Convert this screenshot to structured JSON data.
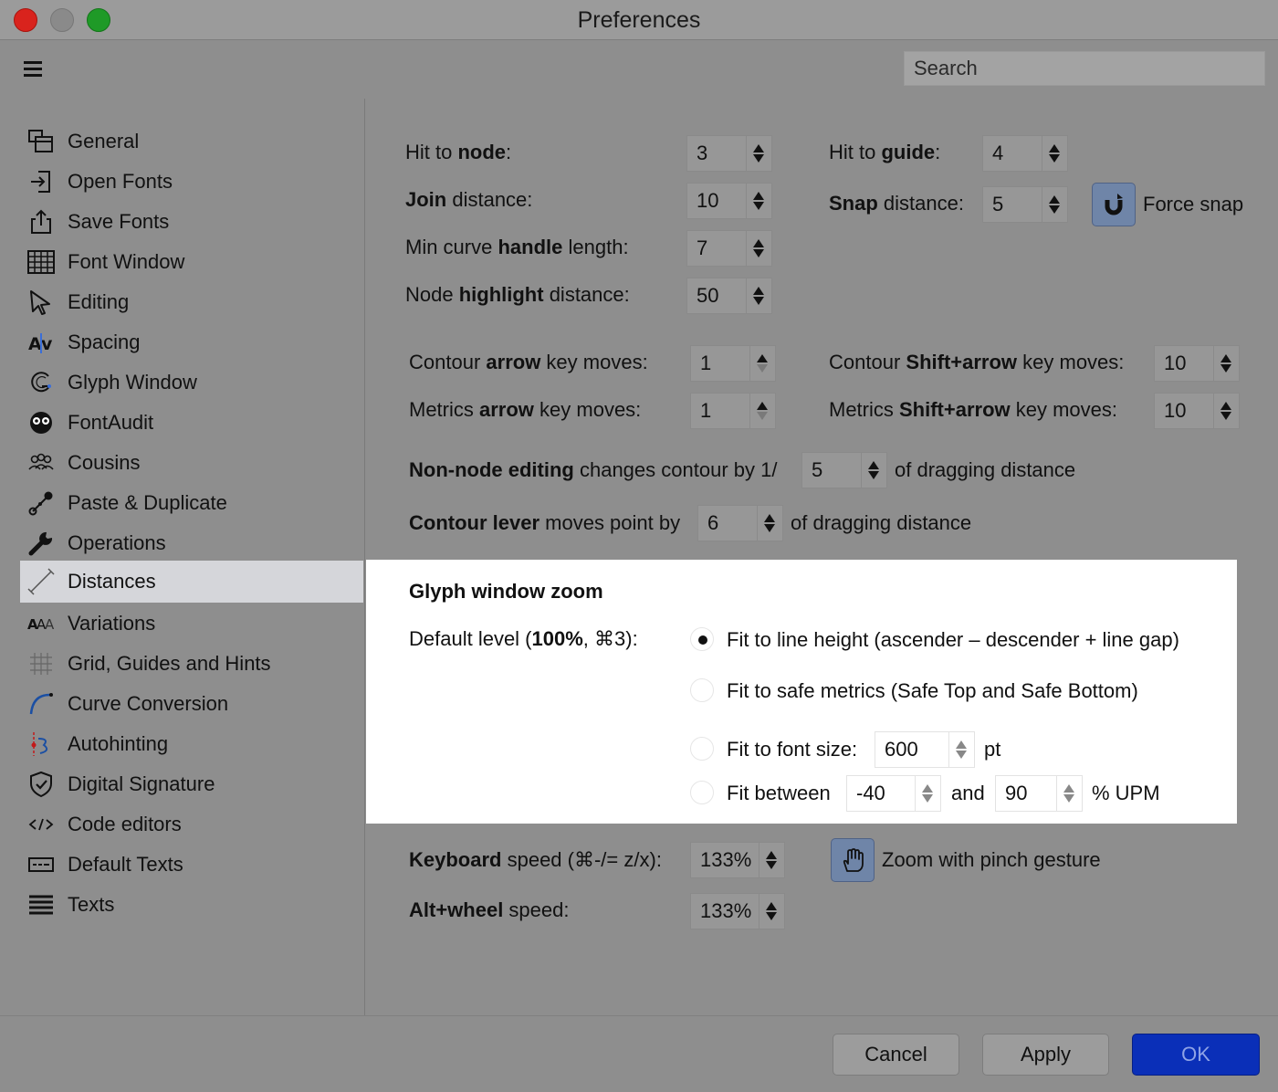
{
  "window": {
    "title": "Preferences"
  },
  "toolbar": {
    "search_placeholder": "Search"
  },
  "sidebar": {
    "items": [
      {
        "label": "General"
      },
      {
        "label": "Open Fonts"
      },
      {
        "label": "Save Fonts"
      },
      {
        "label": "Font Window"
      },
      {
        "label": "Editing"
      },
      {
        "label": "Spacing"
      },
      {
        "label": "Glyph Window"
      },
      {
        "label": "FontAudit"
      },
      {
        "label": "Cousins"
      },
      {
        "label": "Paste & Duplicate"
      },
      {
        "label": "Operations"
      },
      {
        "label": "Distances",
        "selected": true
      },
      {
        "label": "Variations"
      },
      {
        "label": "Grid, Guides and Hints"
      },
      {
        "label": "Curve Conversion"
      },
      {
        "label": "Autohinting"
      },
      {
        "label": "Digital Signature"
      },
      {
        "label": "Code editors"
      },
      {
        "label": "Default Texts"
      },
      {
        "label": "Texts"
      }
    ]
  },
  "main": {
    "hit_to_node": {
      "pre": "Hit to ",
      "bold": "node",
      "post": ":",
      "value": "3"
    },
    "hit_to_guide": {
      "pre": "Hit to ",
      "bold": "guide",
      "post": ":",
      "value": "4"
    },
    "join_distance": {
      "bold": "Join",
      "post": " distance:",
      "value": "10"
    },
    "snap_distance": {
      "bold": "Snap",
      "post": " distance:",
      "value": "5"
    },
    "force_snap": {
      "label": "Force snap"
    },
    "min_curve": {
      "pre": "Min curve ",
      "bold": "handle",
      "post": " length:",
      "value": "7"
    },
    "node_highlight": {
      "pre": "Node ",
      "bold": "highlight",
      "post": " distance:",
      "value": "50"
    },
    "contour_arrow": {
      "pre": "Contour ",
      "bold": "arrow",
      "post": " key moves:",
      "value": "1"
    },
    "contour_shift": {
      "pre": "Contour ",
      "bold": "Shift+arrow",
      "post": " key moves:",
      "value": "10"
    },
    "metrics_arrow": {
      "pre": "Metrics ",
      "bold": "arrow",
      "post": " key moves:",
      "value": "1"
    },
    "metrics_shift": {
      "pre": "Metrics ",
      "bold": "Shift+arrow",
      "post": " key moves:",
      "value": "10"
    },
    "non_node": {
      "bold": "Non-node editing",
      "post": " changes contour by 1/",
      "value": "5",
      "suffix": "of dragging distance"
    },
    "contour_lever": {
      "bold": "Contour lever",
      "post": " moves point by",
      "value": "6",
      "suffix": "of dragging distance"
    },
    "zoom": {
      "heading": "Glyph window zoom",
      "default_pre": "Default level (",
      "default_bold": "100%",
      "default_post": ", ⌘3):",
      "opt_line_height": "Fit to line height (ascender – descender + line gap)",
      "opt_safe_metrics": "Fit to safe metrics (Safe Top and Safe Bottom)",
      "opt_font_size": "Fit to font size:",
      "font_size_value": "600",
      "font_size_unit": "pt",
      "opt_between": "Fit between",
      "between_from": "-40",
      "between_and": "and",
      "between_to": "90",
      "between_unit": "% UPM"
    },
    "keyboard_speed": {
      "bold": "Keyboard",
      "post": " speed (⌘-/= z/x):",
      "value": "133%"
    },
    "pinch": {
      "label": "Zoom with pinch gesture"
    },
    "alt_wheel": {
      "bold": "Alt+wheel",
      "post": " speed:",
      "value": "133%"
    }
  },
  "footer": {
    "cancel": "Cancel",
    "apply": "Apply",
    "ok": "OK"
  }
}
